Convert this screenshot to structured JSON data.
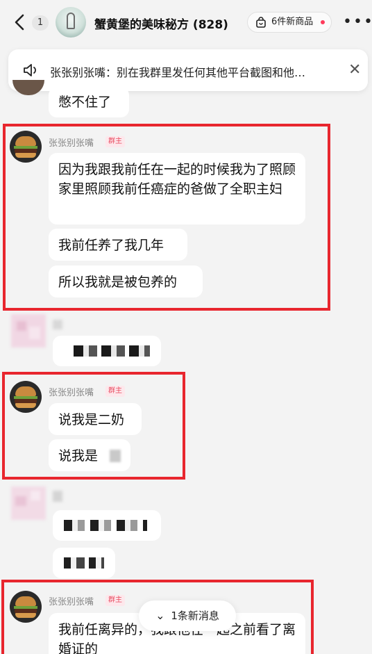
{
  "header": {
    "unread_count": "1",
    "group_title": "蟹黄堡的美味秘方 (828)",
    "shop_label": "6件新商品",
    "more_glyph": "•••"
  },
  "notice": {
    "text": "张张别张嘴：别在我群里发任何其他平台截图和他…",
    "close_glyph": "✕"
  },
  "messages": {
    "partial_top": "憋不住了",
    "group1": {
      "sender": "张张别张嘴",
      "role": "群主",
      "lines": [
        "因为我跟我前任在一起的时候我为了照顾家里照顾我前任癌症的爸做了全职主妇",
        "我前任养了我几年",
        "所以我就是被包养的"
      ]
    },
    "group2": {
      "sender": "张张别张嘴",
      "role": "群主",
      "lines": [
        "说我是二奶",
        "说我是"
      ]
    },
    "group3": {
      "sender": "张张别张嘴",
      "role": "群主",
      "lines": [
        "我前任离异的，我跟他在一起之前看了离婚证的"
      ]
    }
  },
  "new_messages": {
    "label": "1条新消息",
    "chevron": "⌄"
  },
  "colors": {
    "highlight_box": "#e8262e",
    "role_tag": "#e84a5f",
    "background": "#f3f3f3",
    "bubble": "#ffffff"
  }
}
